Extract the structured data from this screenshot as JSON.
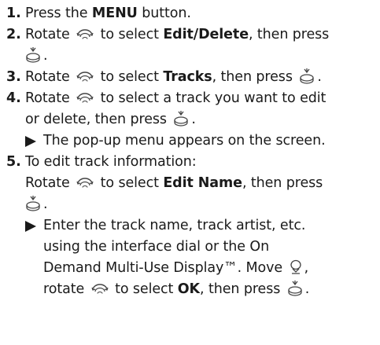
{
  "steps": [
    {
      "num": "1.",
      "pre": "Press the ",
      "bold": "MENU",
      "post": " button."
    },
    {
      "num": "2.",
      "rotate": "Rotate",
      "mid": " to select ",
      "bold": "Edit/Delete",
      "post": ", then press"
    },
    {
      "num": "3.",
      "rotate": "Rotate",
      "mid": " to select ",
      "bold": "Tracks",
      "post": ", then press"
    },
    {
      "num": "4.",
      "rotate": "Rotate",
      "line1_post": " to select a track you want to edit",
      "line2": "or delete, then press"
    },
    {
      "num": "5.",
      "intro": "To edit track information:",
      "rotate": "Rotate",
      "mid": " to select ",
      "bold": "Edit Name",
      "post": ", then press"
    }
  ],
  "result_popup": "The pop-up menu appears on the screen.",
  "result_name": {
    "line1": "Enter the track name, track artist, etc.",
    "line2": "using the interface dial or the On",
    "line3": "Demand Multi-Use Display™. Move",
    "line4_a": "rotate",
    "line4_b": " to select ",
    "line4_bold": "OK",
    "line4_c": ", then press"
  },
  "icons": {
    "dial": "interface-dial-rotate-icon",
    "press": "interface-dial-press-icon",
    "move": "interface-dial-move-icon"
  }
}
